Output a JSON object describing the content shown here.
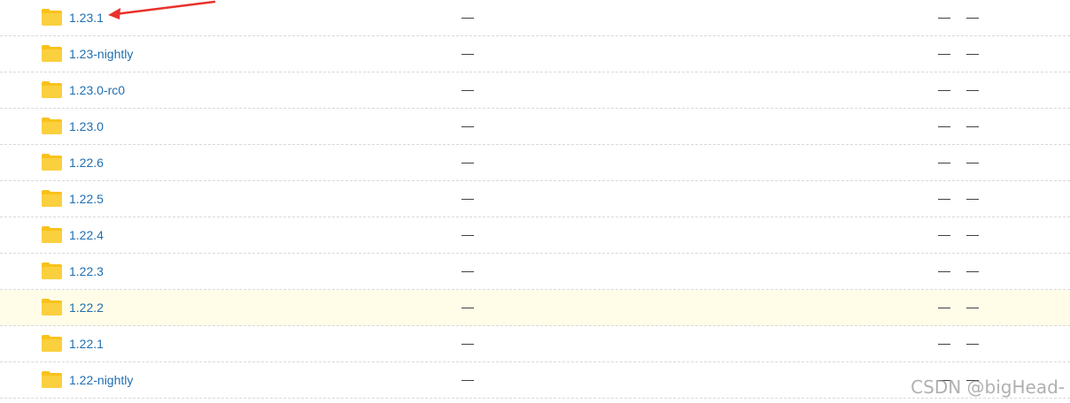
{
  "folders": [
    {
      "name": "1.23.1",
      "size": "—",
      "modified_a": "—",
      "modified_b": "—"
    },
    {
      "name": "1.23-nightly",
      "size": "—",
      "modified_a": "—",
      "modified_b": "—"
    },
    {
      "name": "1.23.0-rc0",
      "size": "—",
      "modified_a": "—",
      "modified_b": "—"
    },
    {
      "name": "1.23.0",
      "size": "—",
      "modified_a": "—",
      "modified_b": "—"
    },
    {
      "name": "1.22.6",
      "size": "—",
      "modified_a": "—",
      "modified_b": "—"
    },
    {
      "name": "1.22.5",
      "size": "—",
      "modified_a": "—",
      "modified_b": "—"
    },
    {
      "name": "1.22.4",
      "size": "—",
      "modified_a": "—",
      "modified_b": "—"
    },
    {
      "name": "1.22.3",
      "size": "—",
      "modified_a": "—",
      "modified_b": "—"
    },
    {
      "name": "1.22.2",
      "size": "—",
      "modified_a": "—",
      "modified_b": "—"
    },
    {
      "name": "1.22.1",
      "size": "—",
      "modified_a": "—",
      "modified_b": "—"
    },
    {
      "name": "1.22-nightly",
      "size": "—",
      "modified_a": "—",
      "modified_b": "—"
    }
  ],
  "highlighted_row": "1.22.2",
  "annotation": {
    "points_to": "1.23.1",
    "color": "#e8322b"
  },
  "watermark": "CSDN @bigHead-",
  "colors": {
    "link": "#1f6fb2",
    "folder": "#f9c21b",
    "highlight_bg": "#fffde8"
  },
  "icons": {
    "folder": "folder-icon",
    "annotation": "red-arrow-icon"
  }
}
